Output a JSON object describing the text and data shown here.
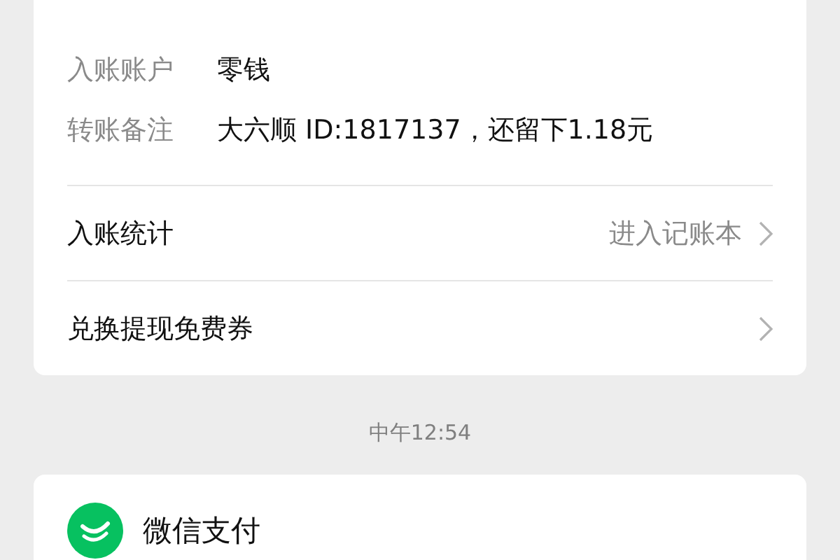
{
  "details": [
    {
      "label": "入账账户",
      "value": "零钱"
    },
    {
      "label": "转账备注",
      "value": "大六顺 ID:1817137，还留下1.18元"
    }
  ],
  "links": [
    {
      "label": "入账统计",
      "action": "进入记账本"
    },
    {
      "label": "兑换提现免费券"
    }
  ],
  "time": "中午12:54",
  "message": {
    "title": "微信支付"
  }
}
